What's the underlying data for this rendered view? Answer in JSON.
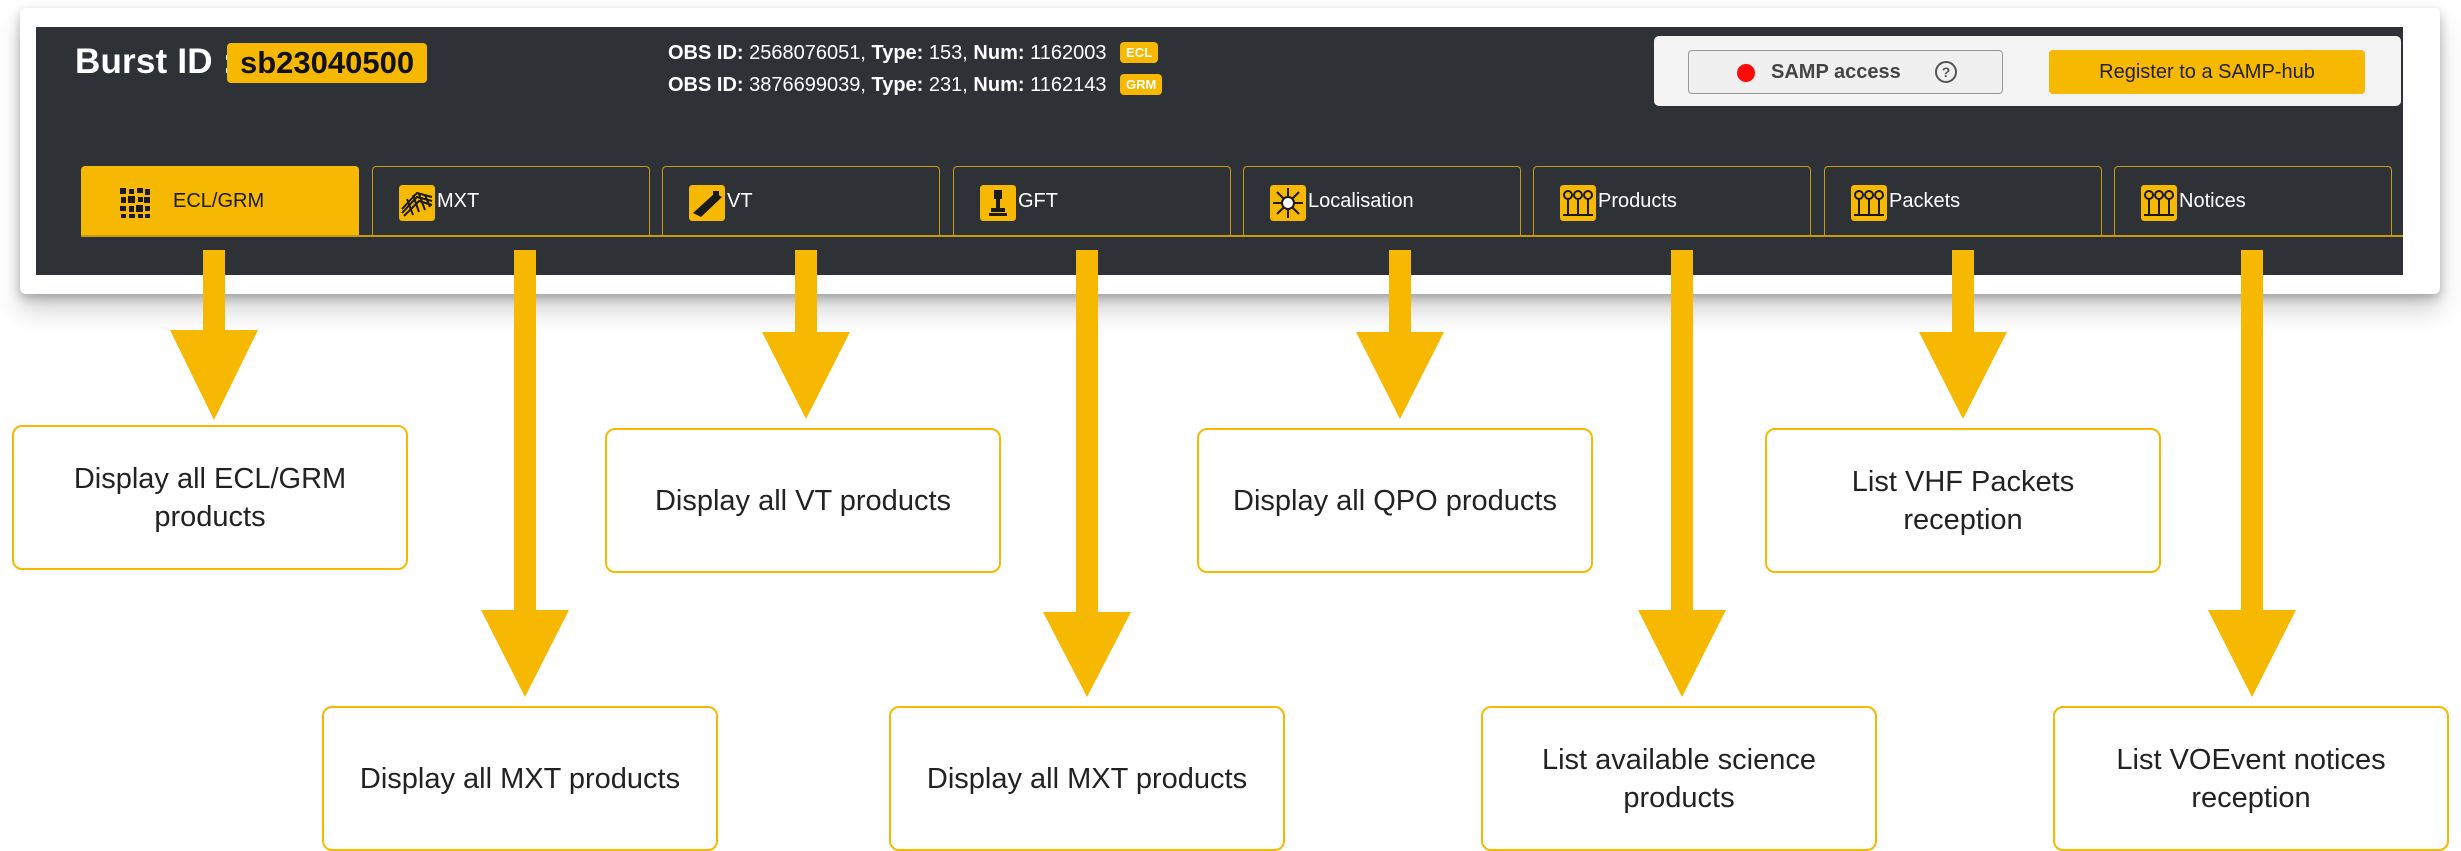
{
  "header": {
    "burst_label": "Burst ID :",
    "burst_id": "sb23040500",
    "obs": [
      {
        "obs_label": "OBS ID:",
        "obs_id": "2568076051,",
        "type_label": "Type:",
        "type": "153,",
        "num_label": "Num:",
        "num": "1162003",
        "badge": "ECL"
      },
      {
        "obs_label": "OBS ID:",
        "obs_id": "3876699039,",
        "type_label": "Type:",
        "type": "231,",
        "num_label": "Num:",
        "num": "1162143",
        "badge": "GRM"
      }
    ],
    "samp_label": "SAMP access",
    "samp_help": "?",
    "register_label": "Register to a SAMP-hub"
  },
  "tabs": [
    {
      "label": "ECL/GRM",
      "icon": "ecl-grm-icon"
    },
    {
      "label": "MXT",
      "icon": "mxt-icon"
    },
    {
      "label": "VT",
      "icon": "vt-icon"
    },
    {
      "label": "GFT",
      "icon": "gft-icon"
    },
    {
      "label": "Localisation",
      "icon": "localisation-icon"
    },
    {
      "label": "Products",
      "icon": "products-icon"
    },
    {
      "label": "Packets",
      "icon": "packets-icon"
    },
    {
      "label": "Notices",
      "icon": "notices-icon"
    }
  ],
  "callouts": [
    "Display all ECL/GRM products",
    "Display all MXT products",
    "Display all VT products",
    "Display all MXT products",
    "Display all QPO products",
    "List available science products",
    "List VHF Packets reception",
    "List VOEvent notices reception"
  ],
  "colors": {
    "accent": "#f6b800",
    "header_bg": "#2e3136",
    "samp_status": "#ff0a0a"
  }
}
